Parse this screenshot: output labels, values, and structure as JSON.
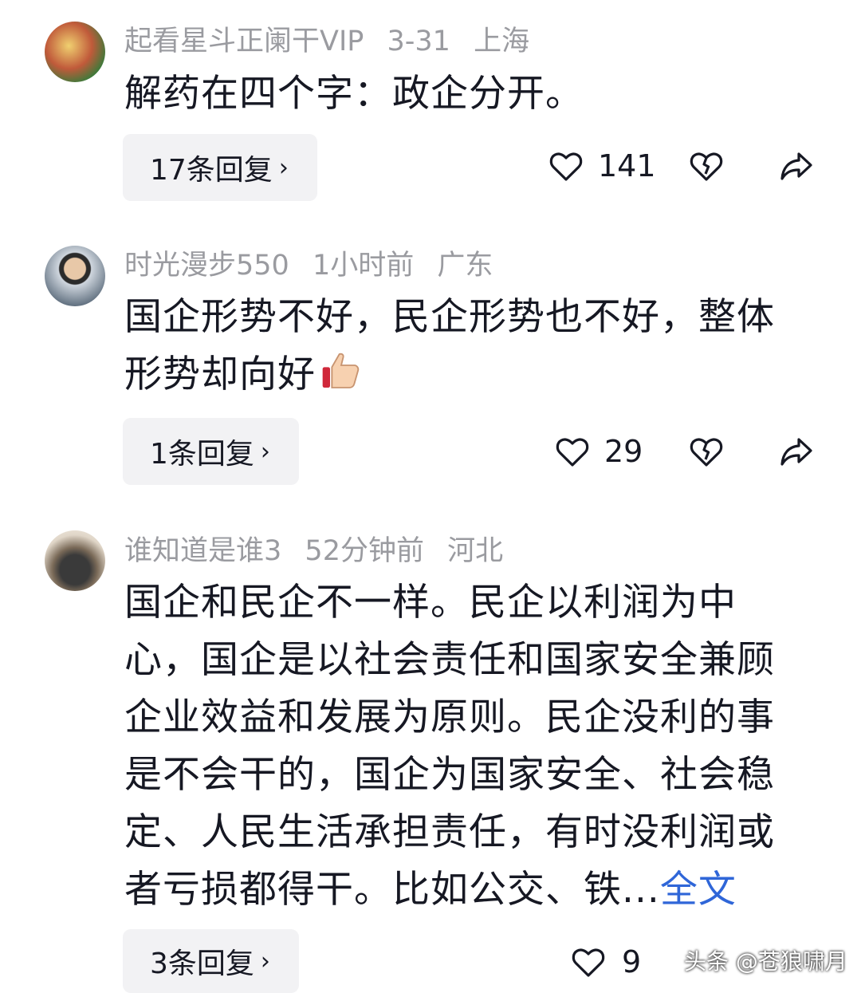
{
  "comments": [
    {
      "username": "起看星斗正阑干VIP",
      "time": "3-31",
      "location": "上海",
      "text": "解药在四个字：政企分开。",
      "reply_label": "17条回复",
      "likes": "141"
    },
    {
      "username": "时光漫步550",
      "time": "1小时前",
      "location": "广东",
      "text": "国企形势不好，民企形势也不好，整体形势却向好",
      "reply_label": "1条回复",
      "likes": "29"
    },
    {
      "username": "谁知道是谁3",
      "time": "52分钟前",
      "location": "河北",
      "text": "国企和民企不一样。民企以利润为中心，国企是以社会责任和国家安全兼顾企业效益和发展为原则。民企没利的事是不会干的，国企为国家安全、社会稳定、人民生活承担责任，有时没利润或者亏损都得干。比如公交、铁...",
      "full_text_link": "全文",
      "reply_label": "3条回复",
      "likes": "9"
    }
  ],
  "icons": {
    "like": "heart-outline-icon",
    "dislike": "broken-heart-icon",
    "share": "share-arrow-icon",
    "reply_chevron": "›"
  },
  "watermark": "头条 @苍狼啸月",
  "colors": {
    "meta": "#9a9ba0",
    "link": "#2f66d8",
    "reply_bg": "#f2f2f4"
  }
}
